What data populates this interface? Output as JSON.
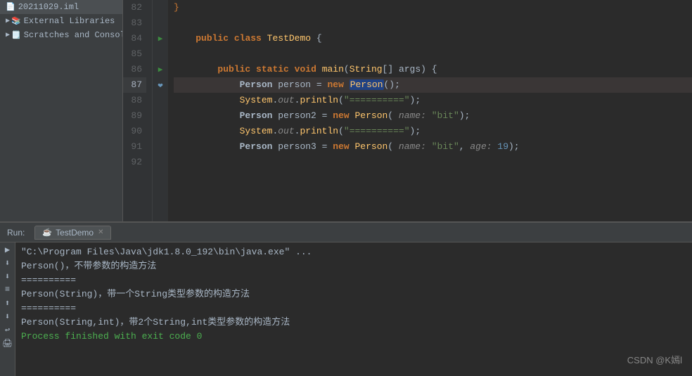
{
  "sidebar": {
    "items": [
      {
        "label": "20211029.iml",
        "icon": "📄",
        "indent": 0
      },
      {
        "label": "External Libraries",
        "icon": "📚",
        "indent": 1,
        "arrow": "▶"
      },
      {
        "label": "Scratches and Console",
        "icon": "🗒️",
        "indent": 1,
        "arrow": "▶"
      }
    ]
  },
  "editor": {
    "lines": [
      {
        "num": 82,
        "content": "    }",
        "highlight": false,
        "gutter": ""
      },
      {
        "num": 83,
        "content": "",
        "highlight": false,
        "gutter": ""
      },
      {
        "num": 84,
        "content": "    public class TestDemo {",
        "highlight": false,
        "gutter": "▶"
      },
      {
        "num": 85,
        "content": "",
        "highlight": false,
        "gutter": ""
      },
      {
        "num": 86,
        "content": "        public static void main(String[] args) {",
        "highlight": false,
        "gutter": "▶"
      },
      {
        "num": 87,
        "content": "            Person person = new Person();",
        "highlight": true,
        "gutter": ""
      },
      {
        "num": 88,
        "content": "            System.out.println(\"==========\");",
        "highlight": false,
        "gutter": ""
      },
      {
        "num": 89,
        "content": "            Person person2 = new Person( name: \"bit\");",
        "highlight": false,
        "gutter": ""
      },
      {
        "num": 90,
        "content": "            System.out.println(\"==========\");",
        "highlight": false,
        "gutter": ""
      },
      {
        "num": 91,
        "content": "            Person person3 = new Person( name: \"bit\", age: 19);",
        "highlight": false,
        "gutter": ""
      },
      {
        "num": 92,
        "content": "",
        "highlight": false,
        "gutter": ""
      }
    ]
  },
  "run_panel": {
    "run_label": "Run:",
    "tab_label": "TestDemo",
    "tab_icon": "☕",
    "console_lines": [
      {
        "text": "\"C:\\Program Files\\Java\\jdk1.8.0_192\\bin\\java.exe\" ...",
        "type": "cmd"
      },
      {
        "text": "Person()，不带参数的构造方法",
        "type": "output"
      },
      {
        "text": "==========",
        "type": "output"
      },
      {
        "text": "Person(String)，带一个String类型参数的构造方法",
        "type": "output"
      },
      {
        "text": "==========",
        "type": "output"
      },
      {
        "text": "Person(String,int)，带2个String,int类型参数的构造方法",
        "type": "output"
      },
      {
        "text": "",
        "type": "output"
      },
      {
        "text": "Process finished with exit code 0",
        "type": "success"
      }
    ]
  },
  "watermark": "CSDN @K嫣l",
  "toolbar_buttons": [
    "▶",
    "⬇",
    "⬇",
    "≡",
    "⬆",
    "⬇",
    "↩",
    "🖨"
  ]
}
